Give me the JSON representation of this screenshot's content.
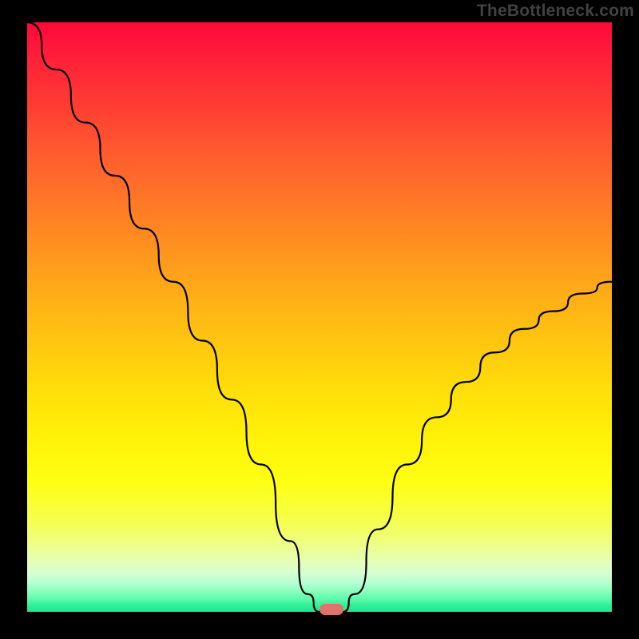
{
  "watermark": "TheBottleneck.com",
  "chart_data": {
    "type": "line",
    "title": "",
    "xlabel": "",
    "ylabel": "",
    "ylim": [
      0,
      100
    ],
    "xlim": [
      0,
      100
    ],
    "categories": [
      0,
      5,
      10,
      15,
      20,
      25,
      30,
      35,
      40,
      45,
      48,
      50,
      52,
      54,
      56,
      60,
      65,
      70,
      75,
      80,
      85,
      90,
      95,
      100
    ],
    "series": [
      {
        "name": "curve",
        "values": [
          100,
          92,
          83,
          74,
          65,
          56,
          46,
          36,
          25,
          12,
          3,
          0,
          0,
          0,
          3,
          14,
          25,
          33,
          39,
          44,
          48,
          51,
          54,
          56
        ]
      }
    ],
    "marker": {
      "x": 52,
      "y": 0
    },
    "background_gradient": {
      "stops": [
        {
          "offset": 0.0,
          "color": "#ff083a"
        },
        {
          "offset": 0.06,
          "color": "#ff1f39"
        },
        {
          "offset": 0.14,
          "color": "#ff3c33"
        },
        {
          "offset": 0.22,
          "color": "#ff5b2f"
        },
        {
          "offset": 0.3,
          "color": "#ff7627"
        },
        {
          "offset": 0.38,
          "color": "#ff911f"
        },
        {
          "offset": 0.46,
          "color": "#ffad17"
        },
        {
          "offset": 0.54,
          "color": "#ffc510"
        },
        {
          "offset": 0.62,
          "color": "#ffdd0a"
        },
        {
          "offset": 0.7,
          "color": "#fff107"
        },
        {
          "offset": 0.78,
          "color": "#feff12"
        },
        {
          "offset": 0.84,
          "color": "#f6ff48"
        },
        {
          "offset": 0.885,
          "color": "#eeff85"
        },
        {
          "offset": 0.915,
          "color": "#e5ffb8"
        },
        {
          "offset": 0.935,
          "color": "#d5ffd4"
        },
        {
          "offset": 0.952,
          "color": "#b3ffd2"
        },
        {
          "offset": 0.965,
          "color": "#8affbf"
        },
        {
          "offset": 0.978,
          "color": "#5dfbab"
        },
        {
          "offset": 0.988,
          "color": "#34f19a"
        },
        {
          "offset": 1.0,
          "color": "#16e78f"
        }
      ]
    }
  },
  "colors": {
    "curve_stroke": "#000000",
    "marker_fill": "#e1736c"
  }
}
